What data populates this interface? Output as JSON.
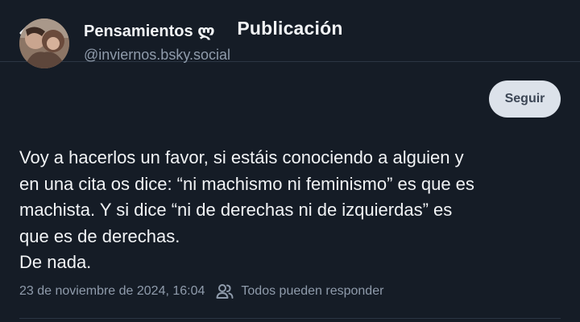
{
  "header": {
    "title": "Publicación",
    "back_icon": "chevron-left-icon"
  },
  "author": {
    "display_name": "Pensamientos ლ",
    "handle": "@inviernos.bsky.social",
    "avatar_icon": "avatar-photo"
  },
  "follow_button": {
    "label": "Seguir"
  },
  "post": {
    "lines": [
      "Voy a hacerlos un favor, si estáis conociendo a alguien y",
      "en una cita os dice: “ni machismo ni feminismo” es que es",
      "machista. Y si dice “ni de derechas ni de izquierdas” es",
      "que es de derechas.",
      "De nada."
    ],
    "timestamp": "23 de noviembre de 2024, 16:04",
    "reply_setting": "Todos pueden responder",
    "reply_icon": "people-icon"
  },
  "colors": {
    "background": "#151c26",
    "text": "#f1f3f5",
    "muted": "#8f9bab",
    "divider": "#2b3543",
    "follow_bg": "#dce2ea"
  }
}
